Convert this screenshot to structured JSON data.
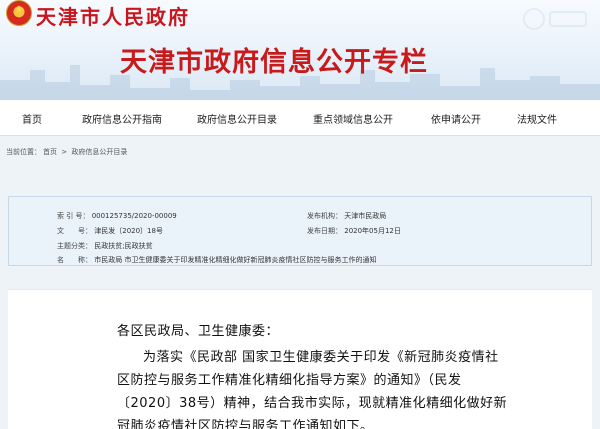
{
  "header": {
    "gov_name": "天津市人民政府",
    "banner_title": "天津市政府信息公开专栏"
  },
  "nav": {
    "items": [
      {
        "label": "首页"
      },
      {
        "label": "政府信息公开指南"
      },
      {
        "label": "政府信息公开目录"
      },
      {
        "label": "重点领域信息公开"
      },
      {
        "label": "依申请公开"
      },
      {
        "label": "法规文件"
      }
    ]
  },
  "breadcrumb": {
    "prefix": "当前位置：",
    "home": "首页",
    "separator": " > ",
    "current": "政府信息公开目录"
  },
  "info": {
    "index_label": "索 引 号：",
    "index_value": "000125735/2020-00009",
    "agency_label": "发布机构：",
    "agency_value": "天津市民政局",
    "doc_label": "文　　号：",
    "doc_value": "津民发〔2020〕18号",
    "date_label": "发布日期：",
    "date_value": "2020年05月12日",
    "topic_label": "主题分类：",
    "topic_value": "民政扶贫;民政扶贫",
    "title_label": "名　　称：",
    "title_value": "市民政局 市卫生健康委关于印发精准化精细化做好新冠肺炎疫情社区防控与服务工作的通知"
  },
  "body": {
    "salutation": "各区民政局、卫生健康委：",
    "line1": "为落实《民政部 国家卫生健康委关于印发《新冠肺炎疫情社",
    "line2": "区防控与服务工作精准化精细化指导方案》的通知》（民发",
    "line3": "〔2020〕38号）精神，结合我市实际，现就精准化精细化做好新",
    "line4": "冠肺炎疫情社区防控与服务工作通知如下。"
  },
  "colors": {
    "banner_title": "#c81a1a",
    "gov_name": "#c8161d",
    "info_bg": "#eaf2fa"
  }
}
